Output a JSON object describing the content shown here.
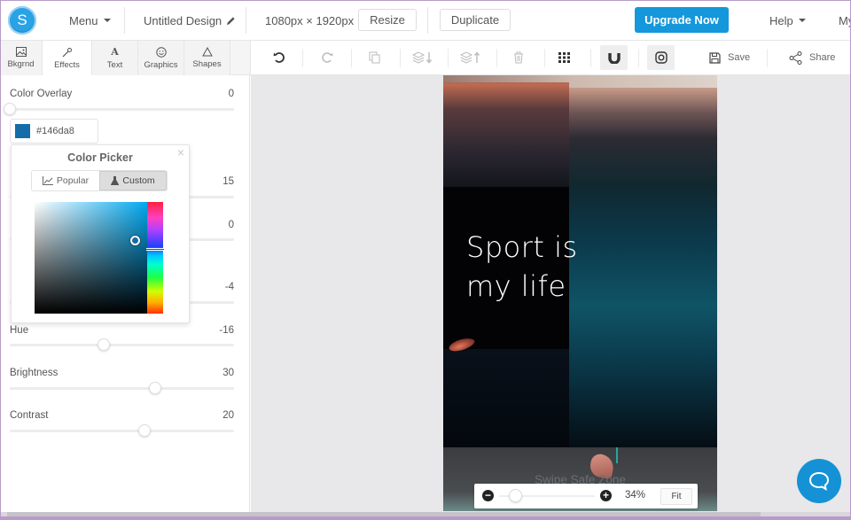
{
  "app": {
    "logo_letter": "S",
    "menu_label": "Menu",
    "design_title": "Untitled Design",
    "dimensions": "1080px × 1920px",
    "resize_label": "Resize",
    "duplicate_label": "Duplicate",
    "upgrade_label": "Upgrade Now",
    "help_label": "Help",
    "account_label": "My",
    "accent_color": "#1497db"
  },
  "tabs": [
    {
      "label": "Bkgrnd",
      "icon": "image-icon",
      "active": false
    },
    {
      "label": "Effects",
      "icon": "magic-wand-icon",
      "active": true
    },
    {
      "label": "Text",
      "icon": "text-icon",
      "active": false
    },
    {
      "label": "Graphics",
      "icon": "smiley-icon",
      "active": false
    },
    {
      "label": "Shapes",
      "icon": "triangle-icon",
      "active": false
    }
  ],
  "toolbar": {
    "items": [
      {
        "name": "undo",
        "icon": "undo-icon",
        "enabled": true
      },
      {
        "name": "redo",
        "icon": "redo-icon",
        "enabled": false
      },
      {
        "name": "copy",
        "icon": "copy-icon",
        "enabled": false
      },
      {
        "name": "send-backward",
        "icon": "layer-down-icon",
        "enabled": false
      },
      {
        "name": "bring-forward",
        "icon": "layer-up-icon",
        "enabled": false
      },
      {
        "name": "delete",
        "icon": "trash-icon",
        "enabled": false
      },
      {
        "name": "grid",
        "icon": "grid-icon",
        "enabled": true
      },
      {
        "name": "snap",
        "icon": "magnet-icon",
        "enabled": true
      },
      {
        "name": "instagram",
        "icon": "instagram-icon",
        "enabled": true
      }
    ],
    "save_label": "Save",
    "share_label": "Share"
  },
  "effects": {
    "color_overlay": {
      "label": "Color Overlay",
      "value": "0",
      "fraction": 0.0
    },
    "overlay_color": {
      "hex": "#146da8",
      "label": "#146da8"
    },
    "hidden_sliders": [
      {
        "value": "15",
        "fraction": 0.6
      },
      {
        "value": "0",
        "fraction": 0.5
      },
      {
        "value": "-4",
        "fraction": 0.48
      }
    ],
    "hue": {
      "label": "Hue",
      "value": "-16",
      "fraction": 0.42
    },
    "brightness": {
      "label": "Brightness",
      "value": "30",
      "fraction": 0.65
    },
    "contrast": {
      "label": "Contrast",
      "value": "20",
      "fraction": 0.6
    }
  },
  "color_picker": {
    "title": "Color Picker",
    "close": "×",
    "tab_popular": "Popular",
    "tab_custom": "Custom",
    "active_tab": "Custom",
    "selected_hex": "#146da8"
  },
  "canvas": {
    "text": "Sport is\nmy life",
    "safe_zone_label": "Swipe Safe Zone"
  },
  "zoom": {
    "value": "34%",
    "fit_label": "Fit",
    "fraction": 0.12
  }
}
